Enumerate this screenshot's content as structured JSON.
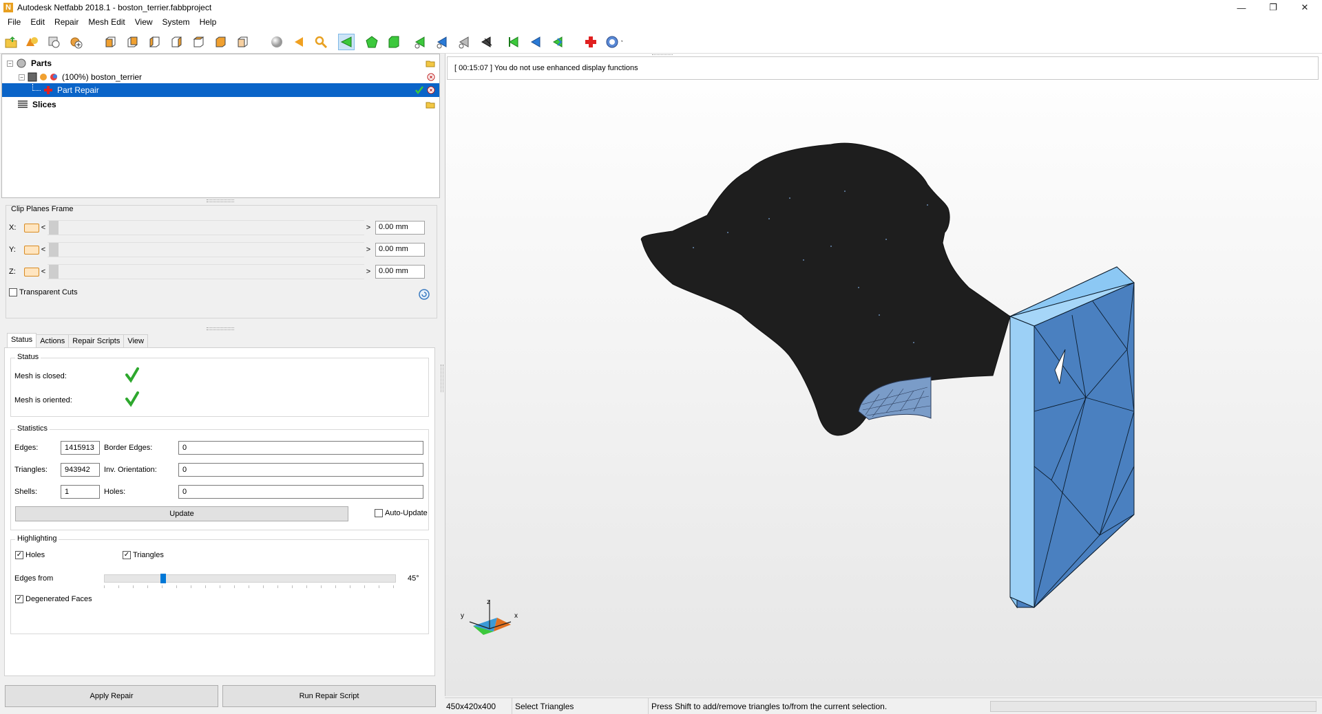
{
  "window": {
    "title": "Autodesk Netfabb 2018.1 - boston_terrier.fabbproject",
    "app_icon_letter": "N",
    "minimize": "—",
    "restore": "❐",
    "close": "✕"
  },
  "menu": [
    "File",
    "Edit",
    "Repair",
    "Mesh Edit",
    "View",
    "System",
    "Help"
  ],
  "tree": {
    "parts": "Parts",
    "part_name": "(100%) boston_terrier",
    "repair": "Part Repair",
    "slices": "Slices",
    "collapse_symbol": "−"
  },
  "clip": {
    "title": "Clip Planes Frame",
    "axes": [
      {
        "label": "X:",
        "value": "0.00 mm"
      },
      {
        "label": "Y:",
        "value": "0.00 mm"
      },
      {
        "label": "Z:",
        "value": "0.00 mm"
      }
    ],
    "left_arrow": "<",
    "right_arrow": ">",
    "transparent_cuts": "Transparent Cuts"
  },
  "tabs": [
    "Status",
    "Actions",
    "Repair Scripts",
    "View"
  ],
  "status_section": {
    "title": "Status",
    "closed_label": "Mesh is closed:",
    "oriented_label": "Mesh is oriented:"
  },
  "statistics": {
    "title": "Statistics",
    "edges_label": "Edges:",
    "edges": "1415913",
    "border_edges_label": "Border Edges:",
    "border_edges": "0",
    "triangles_label": "Triangles:",
    "triangles": "943942",
    "inv_orientation_label": "Inv. Orientation:",
    "inv_orientation": "0",
    "shells_label": "Shells:",
    "shells": "1",
    "holes_label": "Holes:",
    "holes": "0",
    "update": "Update",
    "auto_update": "Auto-Update"
  },
  "highlighting": {
    "title": "Highlighting",
    "holes": "Holes",
    "triangles": "Triangles",
    "edges_from": "Edges from",
    "angle": "45°",
    "angle_fraction": 0.2,
    "degenerated": "Degenerated Faces",
    "checkmark": "✓"
  },
  "buttons": {
    "apply_repair": "Apply Repair",
    "run_script": "Run Repair Script"
  },
  "log": "[ 00:15:07 ] You do not use enhanced display functions",
  "axes_gizmo": {
    "x": "x",
    "y": "y",
    "z": "z"
  },
  "statusbar": {
    "dimensions": "450x420x400",
    "mode": "Select Triangles",
    "hint": "Press Shift to add/remove triangles to/from the current selection."
  },
  "colors": {
    "selection": "#0a64c8",
    "mesh": "#1e1e1e",
    "box_face": "#4a80c0",
    "box_side": "#8cc8f4",
    "check_green": "#2ea82e"
  }
}
